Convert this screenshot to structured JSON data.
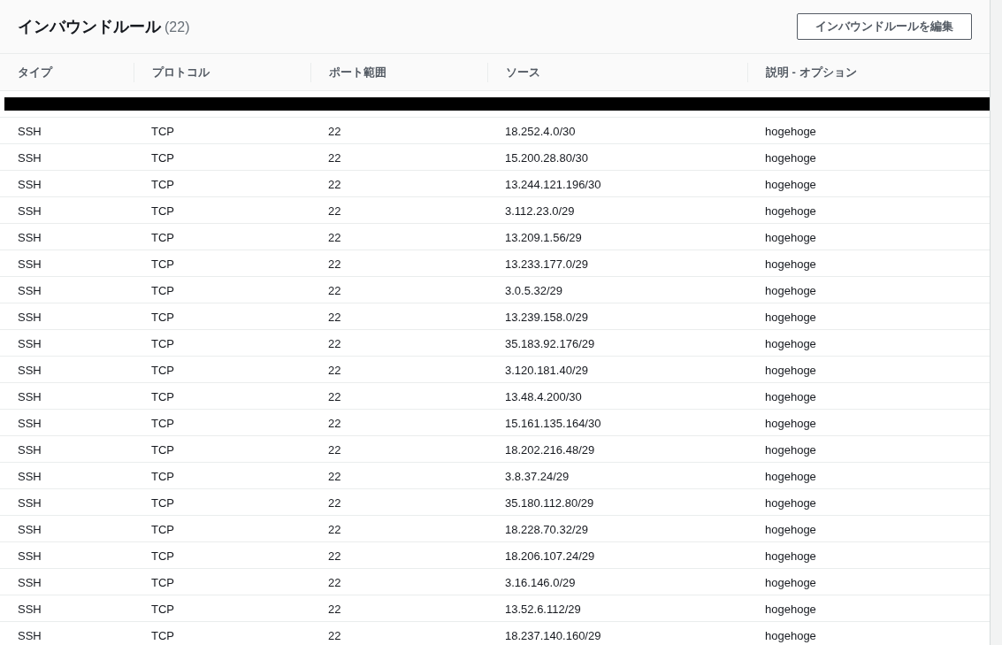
{
  "panel": {
    "title": "インバウンドルール",
    "count": "(22)",
    "edit_button": "インバウンドルールを編集"
  },
  "table": {
    "columns": [
      "タイプ",
      "プロトコル",
      "ポート範囲",
      "ソース",
      "説明 - オプション"
    ],
    "rows": [
      [
        "SSH",
        "TCP",
        "22",
        "18.252.4.0/30",
        "hogehoge"
      ],
      [
        "SSH",
        "TCP",
        "22",
        "15.200.28.80/30",
        "hogehoge"
      ],
      [
        "SSH",
        "TCP",
        "22",
        "13.244.121.196/30",
        "hogehoge"
      ],
      [
        "SSH",
        "TCP",
        "22",
        "3.112.23.0/29",
        "hogehoge"
      ],
      [
        "SSH",
        "TCP",
        "22",
        "13.209.1.56/29",
        "hogehoge"
      ],
      [
        "SSH",
        "TCP",
        "22",
        "13.233.177.0/29",
        "hogehoge"
      ],
      [
        "SSH",
        "TCP",
        "22",
        "3.0.5.32/29",
        "hogehoge"
      ],
      [
        "SSH",
        "TCP",
        "22",
        "13.239.158.0/29",
        "hogehoge"
      ],
      [
        "SSH",
        "TCP",
        "22",
        "35.183.92.176/29",
        "hogehoge"
      ],
      [
        "SSH",
        "TCP",
        "22",
        "3.120.181.40/29",
        "hogehoge"
      ],
      [
        "SSH",
        "TCP",
        "22",
        "13.48.4.200/30",
        "hogehoge"
      ],
      [
        "SSH",
        "TCP",
        "22",
        "15.161.135.164/30",
        "hogehoge"
      ],
      [
        "SSH",
        "TCP",
        "22",
        "18.202.216.48/29",
        "hogehoge"
      ],
      [
        "SSH",
        "TCP",
        "22",
        "3.8.37.24/29",
        "hogehoge"
      ],
      [
        "SSH",
        "TCP",
        "22",
        "35.180.112.80/29",
        "hogehoge"
      ],
      [
        "SSH",
        "TCP",
        "22",
        "18.228.70.32/29",
        "hogehoge"
      ],
      [
        "SSH",
        "TCP",
        "22",
        "18.206.107.24/29",
        "hogehoge"
      ],
      [
        "SSH",
        "TCP",
        "22",
        "3.16.146.0/29",
        "hogehoge"
      ],
      [
        "SSH",
        "TCP",
        "22",
        "13.52.6.112/29",
        "hogehoge"
      ],
      [
        "SSH",
        "TCP",
        "22",
        "18.237.140.160/29",
        "hogehoge"
      ]
    ]
  }
}
